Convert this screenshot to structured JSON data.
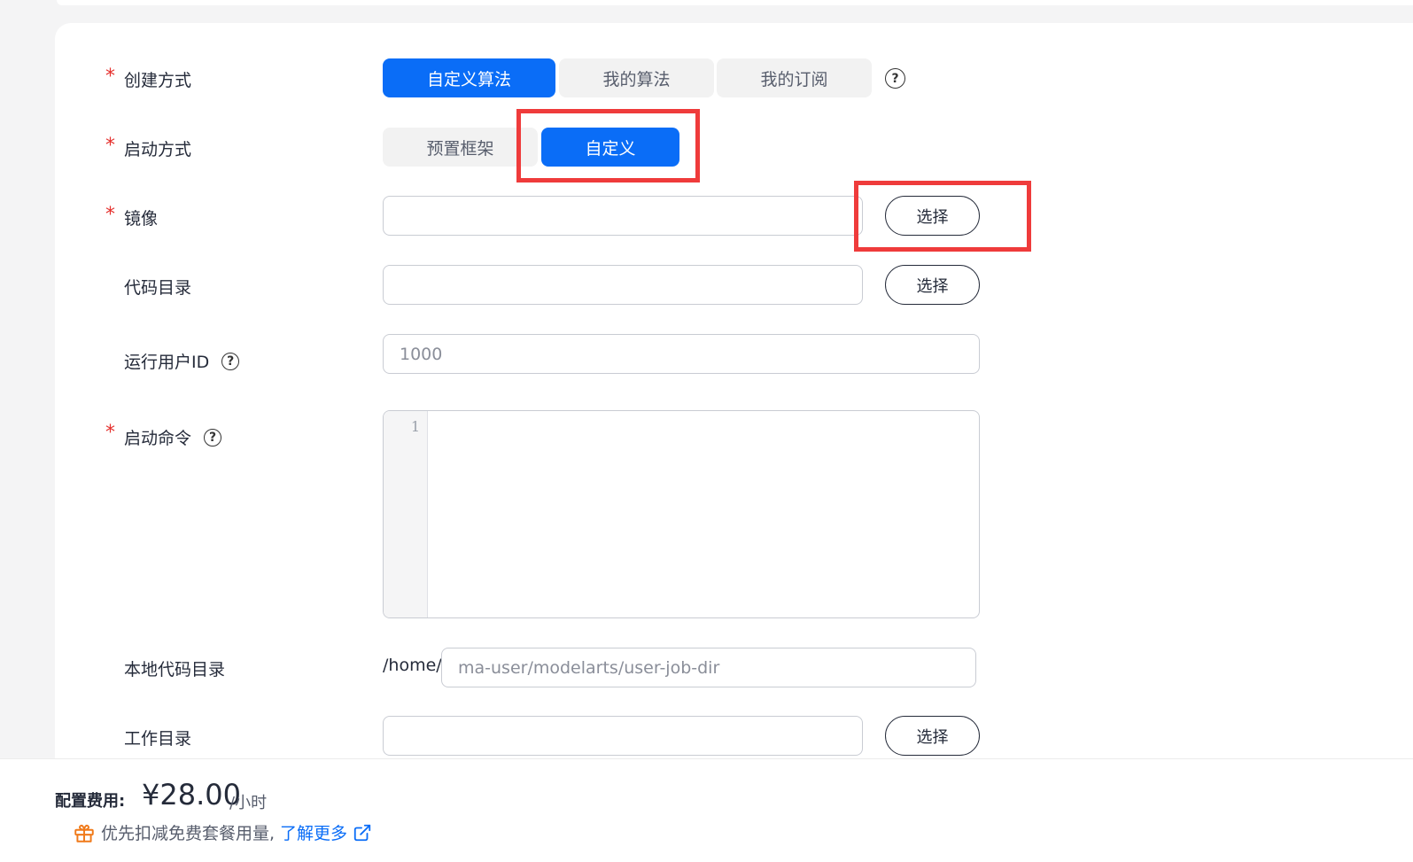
{
  "form": {
    "create_method": {
      "label": "创建方式",
      "options": [
        "自定义算法",
        "我的算法",
        "我的订阅"
      ],
      "selected": "自定义算法"
    },
    "launch_method": {
      "label": "启动方式",
      "options": [
        "预置框架",
        "自定义"
      ],
      "selected": "自定义"
    },
    "image": {
      "label": "镜像",
      "value": "",
      "button": "选择"
    },
    "code_dir": {
      "label": "代码目录",
      "value": "",
      "button": "选择"
    },
    "run_user_id": {
      "label": "运行用户ID",
      "placeholder": "1000"
    },
    "launch_command": {
      "label": "启动命令",
      "line_number": "1"
    },
    "local_code_dir": {
      "label": "本地代码目录",
      "prefix": "/home/",
      "placeholder": "ma-user/modelarts/user-job-dir"
    },
    "work_dir": {
      "label": "工作目录",
      "value": "",
      "button": "选择"
    },
    "required_mark": "*",
    "help_mark": "?"
  },
  "footer": {
    "fee_label": "配置费用:",
    "fee_value": "¥28.00",
    "fee_unit": "/小时",
    "tip_text": "优先扣减免费套餐用量,",
    "tip_link": "了解更多"
  },
  "colors": {
    "primary": "#0a6df7",
    "required": "#e5312e",
    "highlight": "#ef3b3b",
    "gift": "#f07a1a"
  }
}
